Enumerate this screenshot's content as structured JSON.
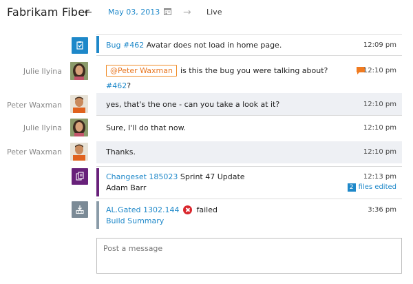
{
  "header": {
    "title": "Fabrikam Fiber",
    "date": "May 03, 2013",
    "live_label": "Live",
    "icons": {
      "back": "arrow-left-icon",
      "calendar": "calendar-icon",
      "forward": "arrow-right-icon"
    }
  },
  "feed": {
    "bug": {
      "icon": "work-item-icon",
      "link": "Bug #462",
      "text": " Avatar does not load in home page.",
      "time": "12:09 pm",
      "accent": "#1e88c9"
    },
    "messages": [
      {
        "sender": "Julie Ilyina",
        "mention": "@Peter Waxman",
        "text": "is this the bug you were talking about?",
        "link": "#462",
        "suffix": "?",
        "time": "12:10 pm"
      },
      {
        "sender": "Peter Waxman",
        "text": "yes, that's the one - can you take a look at it?",
        "time": "12:10 pm"
      },
      {
        "sender": "Julie Ilyina",
        "text": "Sure, I'll do that now.",
        "time": "12:10 pm"
      },
      {
        "sender": "Peter Waxman",
        "text": "Thanks.",
        "time": "12:10 pm"
      }
    ],
    "changeset": {
      "icon": "changeset-icon",
      "link": "Changeset 185023",
      "title": " Sprint 47 Update",
      "author": "Adam Barr",
      "time": "12:13 pm",
      "files_count": "2",
      "files_label": "files edited",
      "accent": "#68217a"
    },
    "build": {
      "icon": "build-icon",
      "link": "AL.Gated 1302.144",
      "status": "failed",
      "summary_link": "Build Summary",
      "time": "3:36 pm",
      "accent": "#8a9ba8"
    }
  },
  "composer": {
    "placeholder": "Post a message"
  },
  "colors": {
    "link": "#1e88c9",
    "mention": "#e87722",
    "alt_row": "#eef0f4",
    "error": "#d9262c"
  }
}
